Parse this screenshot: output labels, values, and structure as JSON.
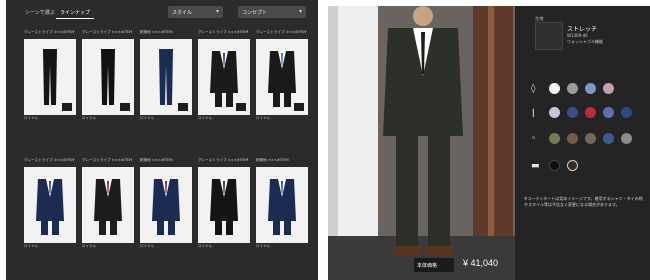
{
  "left": {
    "tabs": [
      "シーンで選ぶ",
      "ラインナップ"
    ],
    "filters": [
      {
        "label": "スタイル"
      },
      {
        "label": "コンセプト"
      }
    ],
    "captions": [
      "グレーストライプ ×××#ITEM",
      "グレーストライプ ×××#ITEM",
      "紺無地 ×××#ITEM",
      "グレーストライプ ×××#ITEM",
      "グレーストライプ ×××#ITEM",
      "グレーストライプ ×××#ITEM",
      "グレーストライプ ×××#ITEM",
      "紺無地 ×××#ITEM",
      "グレーストライプ ×××#ITEM",
      "紺無地 ×××#ITEM"
    ],
    "labels": [
      "ロイヤル",
      "ロイヤル",
      "ロイヤル",
      "ロイヤル",
      "ロイヤル",
      "ロイヤル",
      "ロイヤル",
      "ロイヤル",
      "ロイヤル",
      "ロイヤル"
    ]
  },
  "right": {
    "fabric": {
      "section": "生地",
      "name": "ストレッチ",
      "code": "W1309-46",
      "desc": "ウォッシャブル機能"
    },
    "price_label": "本体価格",
    "price": "¥ 41,040",
    "note": "※コーディネートは見本イメージです。着用するシャツ・タイの柄やスタイル等は予告なく変更になる場合があります。"
  },
  "colors": {
    "left_bg": "#2b2b2b",
    "card_bg": "#f2f2f2",
    "suit_black": "#151515",
    "suit_navy": "#1b2b52",
    "suit_gray": "#2d3029",
    "panel_bg": "#252424"
  },
  "icons": [
    "chevron-down-icon",
    "shirt-icon",
    "tie-icon",
    "collar-icon",
    "swatch-icon"
  ]
}
